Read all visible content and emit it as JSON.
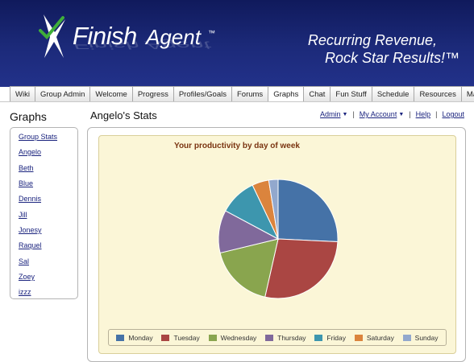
{
  "brand": {
    "name_part1": "Finish",
    "name_part2": "Agent",
    "tm": "™",
    "tagline_line1": "Recurring Revenue,",
    "tagline_line2": "Rock Star Results!™"
  },
  "tabs": [
    {
      "label": "Wiki"
    },
    {
      "label": "Group Admin"
    },
    {
      "label": "Welcome"
    },
    {
      "label": "Progress"
    },
    {
      "label": "Profiles/Goals"
    },
    {
      "label": "Forums"
    },
    {
      "label": "Graphs",
      "active": true
    },
    {
      "label": "Chat"
    },
    {
      "label": "Fun Stuff"
    },
    {
      "label": "Schedule"
    },
    {
      "label": "Resources"
    },
    {
      "label": "Mail"
    }
  ],
  "sidebar": {
    "title": "Graphs",
    "items": [
      {
        "label": "Group Stats"
      },
      {
        "label": "Angelo"
      },
      {
        "label": "Beth"
      },
      {
        "label": "Blue"
      },
      {
        "label": "Dennis"
      },
      {
        "label": "Jill"
      },
      {
        "label": "Jonesy"
      },
      {
        "label": "Raquel"
      },
      {
        "label": "Sal"
      },
      {
        "label": "Zoey"
      },
      {
        "label": "izzz"
      }
    ]
  },
  "page": {
    "title": "Angelo's Stats"
  },
  "top_links": {
    "admin": "Admin",
    "account": "My Account",
    "help": "Help",
    "logout": "Logout"
  },
  "chart_data": {
    "type": "pie",
    "title": "Your productivity by day of week",
    "categories": [
      "Monday",
      "Tuesday",
      "Wednesday",
      "Thursday",
      "Friday",
      "Saturday",
      "Sunday"
    ],
    "values": [
      25.5,
      27.5,
      17.5,
      11.5,
      10,
      4.5,
      2.5
    ],
    "colors": [
      "#4572a7",
      "#aa4643",
      "#89a54e",
      "#80699b",
      "#3d96ae",
      "#db843d",
      "#92a8cd"
    ],
    "legend_position": "bottom",
    "background": "#fbf6d7"
  }
}
